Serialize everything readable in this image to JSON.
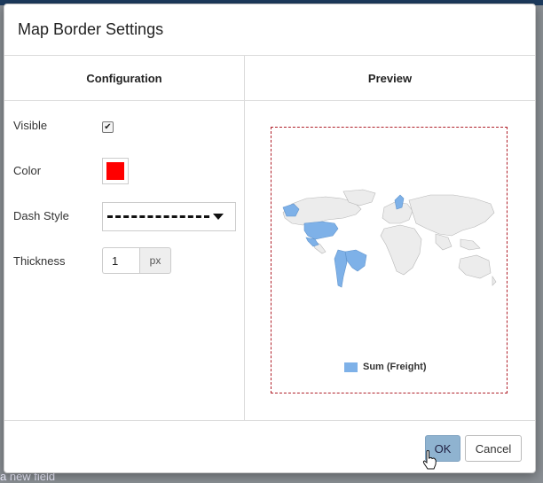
{
  "dialog": {
    "title": "Map Border Settings"
  },
  "configuration": {
    "header": "Configuration",
    "visible_label": "Visible",
    "visible_checked": true,
    "color_label": "Color",
    "color_value": "#ff0000",
    "dash_style_label": "Dash Style",
    "thickness_label": "Thickness",
    "thickness_value": "1",
    "thickness_unit": "px"
  },
  "preview": {
    "header": "Preview",
    "legend_label": "Sum (Freight)",
    "highlight_color": "#7eb1e8",
    "border_color": "#b0202a"
  },
  "buttons": {
    "ok_label": "OK",
    "cancel_label": "Cancel"
  },
  "background": {
    "bottom_field_text": "a new field"
  },
  "icons": {
    "checkbox": "check-mark-icon",
    "dropdown": "caret-down-icon",
    "cursor": "hand-pointer-icon"
  }
}
